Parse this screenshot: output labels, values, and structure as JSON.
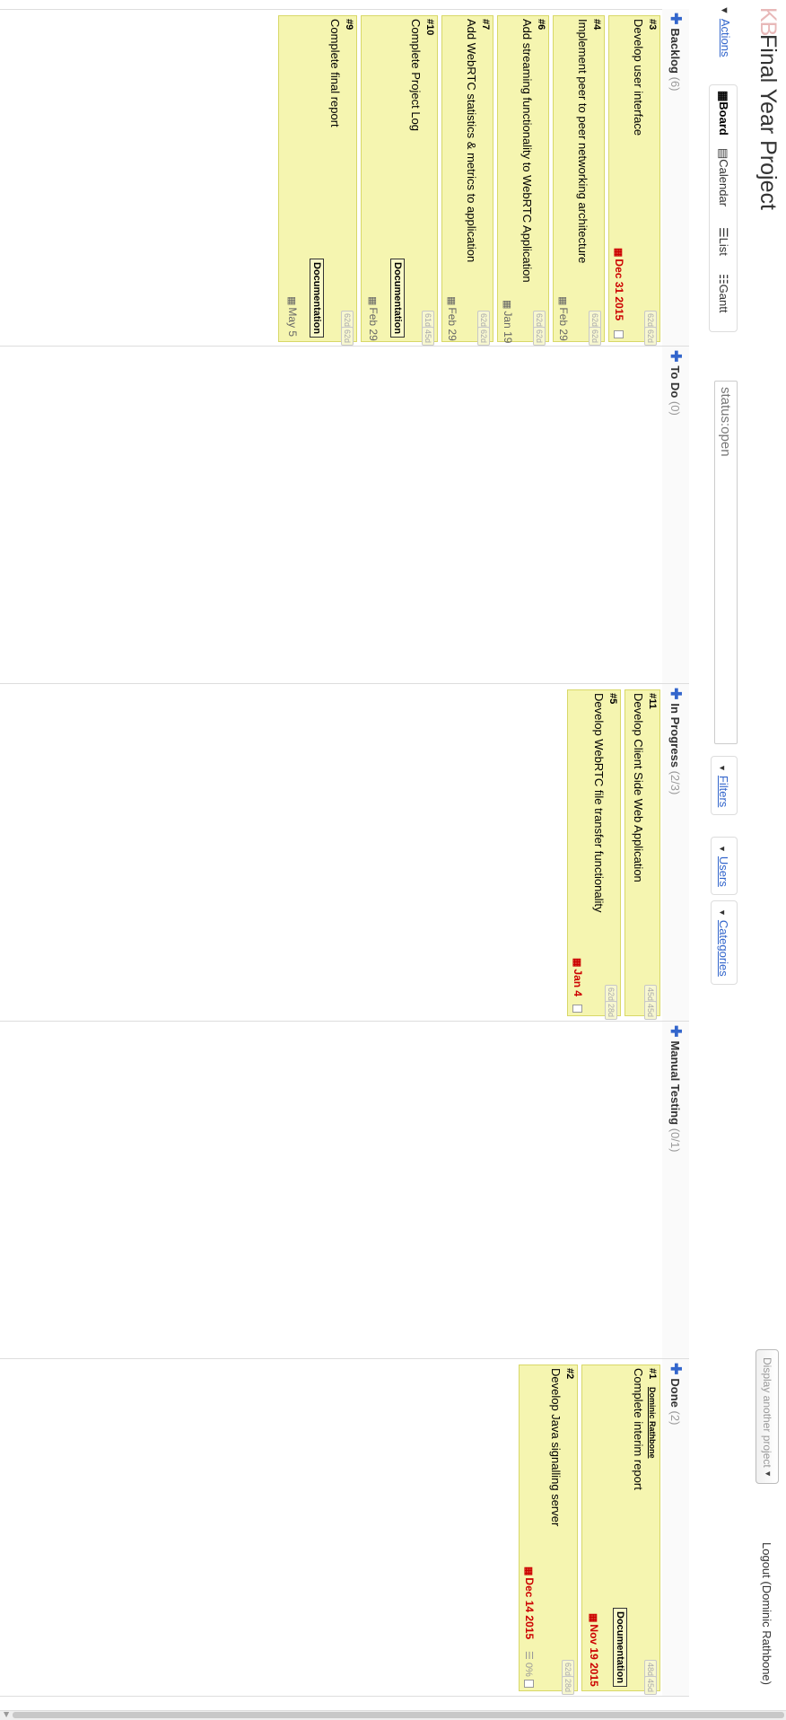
{
  "header": {
    "logo": "KB",
    "title": "Final Year Project",
    "project_selector": "Display another project",
    "logout": "Logout (Dominic Rathbone)"
  },
  "toolbar": {
    "actions": "Actions",
    "views": {
      "board": "Board",
      "calendar": "Calendar",
      "list": "List",
      "gantt": "Gantt"
    },
    "search_value": "status:open",
    "filters": "Filters",
    "users": "Users",
    "categories": "Categories"
  },
  "columns": [
    {
      "name": "Backlog",
      "count": "(6)",
      "cards": [
        {
          "id": "#3",
          "title": "Develop user interface",
          "est1": "62d",
          "est2": "62d",
          "due": "Dec 31 2015",
          "overdue": true
        },
        {
          "id": "#4",
          "title": "Implement peer to peer networking architecture",
          "est1": "62d",
          "est2": "62d",
          "due": "Feb 29",
          "overdue": false
        },
        {
          "id": "#6",
          "title": "Add streaming functionality to WebRTC Application",
          "est1": "62d",
          "est2": "62d",
          "due": "Jan 19",
          "overdue": false
        },
        {
          "id": "#7",
          "title": "Add WebRTC statistics & metrics to application",
          "est1": "62d",
          "est2": "62d",
          "due": "Feb 29",
          "overdue": false
        },
        {
          "id": "#10",
          "title": "Complete Project Log",
          "est1": "61d",
          "est2": "45d",
          "due": "Feb 29",
          "overdue": false,
          "tag": "Documentation"
        },
        {
          "id": "#9",
          "title": "Complete final report",
          "est1": "62d",
          "est2": "62d",
          "due": "May 5",
          "overdue": false,
          "tag": "Documentation"
        }
      ]
    },
    {
      "name": "To Do",
      "count": "(0)",
      "cards": []
    },
    {
      "name": "In Progress",
      "count": "(2/3)",
      "cards": [
        {
          "id": "#11",
          "title": "Develop Client Side Web Application",
          "est1": "45d",
          "est2": "45d"
        },
        {
          "id": "#5",
          "title": "Develop WebRTC file transfer functionality",
          "est1": "62d",
          "est2": "28d",
          "due": "Jan 4",
          "overdue": true
        }
      ]
    },
    {
      "name": "Manual Testing",
      "count": "(0/1)",
      "cards": []
    },
    {
      "name": "Done",
      "count": "(2)",
      "cards": [
        {
          "id": "#1",
          "assignee": "Dominic Rathbone",
          "title": "Complete interim report",
          "est1": "48d",
          "est2": "45d",
          "due": "Nov 19 2015",
          "overdue": true,
          "tag": "Documentation"
        },
        {
          "id": "#2",
          "title": "Develop Java signalling server",
          "est1": "62d",
          "est2": "28d",
          "due": "Dec 14 2015",
          "overdue": true,
          "progress": "0%"
        }
      ]
    }
  ]
}
